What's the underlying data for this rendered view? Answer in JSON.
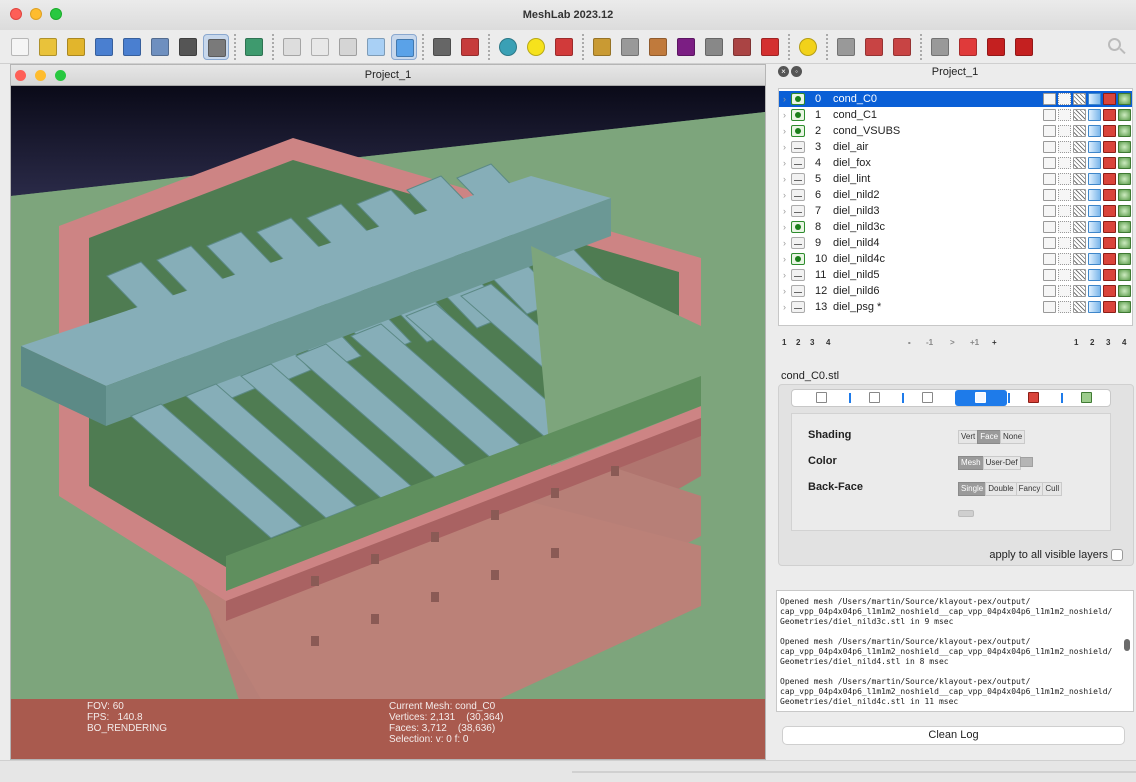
{
  "app": {
    "window_title": "MeshLab 2023.12"
  },
  "toolbar": {
    "icons": [
      {
        "name": "new-project-icon",
        "color": "#f5f5f5"
      },
      {
        "name": "open-project-icon",
        "color": "#e9c23a"
      },
      {
        "name": "import-mesh-icon",
        "color": "#e2b52c"
      },
      {
        "name": "reload-icon",
        "color": "#4a7fd0"
      },
      {
        "name": "reload-all-icon",
        "color": "#4a7fd0"
      },
      {
        "name": "export-mesh-icon",
        "color": "#6e8fbf"
      },
      {
        "name": "snapshot-icon",
        "color": "#555555"
      },
      {
        "name": "layers-icon",
        "color": "#7a7a7a",
        "active": true
      },
      {
        "name": "raster-icon",
        "color": "#3e9a6e"
      },
      {
        "name": "bbox-icon",
        "color": "#dddddd"
      },
      {
        "name": "points-icon",
        "color": "#e8e8e8"
      },
      {
        "name": "wireframe-icon",
        "color": "#d5d5d5"
      },
      {
        "name": "flat-shading-icon",
        "color": "#a9d0f5"
      },
      {
        "name": "smooth-shading-icon",
        "color": "#5aa2e8",
        "active": true
      },
      {
        "name": "grid-icon",
        "color": "#666666"
      },
      {
        "name": "axis-icon",
        "color": "#c63b3b"
      },
      {
        "name": "trackball-icon",
        "color": "#3aa0b5"
      },
      {
        "name": "info-a-icon",
        "color": "#f6e21c"
      },
      {
        "name": "axes-icon",
        "color": "#d13a3a"
      },
      {
        "name": "rough-pen-icon",
        "color": "#c99a33"
      },
      {
        "name": "raster-align-icon",
        "color": "#999999"
      },
      {
        "name": "paint-icon",
        "color": "#c07a3c"
      },
      {
        "name": "p-tool-icon",
        "color": "#7b1e83"
      },
      {
        "name": "select-vertices-icon",
        "color": "#888888"
      },
      {
        "name": "select-faces-icon",
        "color": "#aa4444"
      },
      {
        "name": "georef-icon",
        "color": "#d43030"
      },
      {
        "name": "info-i-icon",
        "color": "#f2d21a"
      },
      {
        "name": "select-conn-icon",
        "color": "#999999"
      },
      {
        "name": "select-faces-alt-icon",
        "color": "#c84444"
      },
      {
        "name": "select-more-icon",
        "color": "#c84444"
      },
      {
        "name": "select-clear-icon",
        "color": "#999999"
      },
      {
        "name": "delete-vertices-icon",
        "color": "#e03a3a"
      },
      {
        "name": "delete-faces-icon",
        "color": "#c42020"
      },
      {
        "name": "delete-all-icon",
        "color": "#c42020"
      }
    ]
  },
  "subwindow": {
    "title": "Project_1"
  },
  "info_left": [
    "FOV: 60",
    "FPS:   140.8",
    "BO_RENDERING"
  ],
  "info_right": [
    "Current Mesh: cond_C0",
    "Vertices: 2,131    (30,364)",
    "Faces: 3,712    (38,636)",
    "Selection: v: 0 f: 0"
  ],
  "panel": {
    "title": "Project_1",
    "layers": [
      {
        "id": "0",
        "name": "cond_C0",
        "visible": true,
        "selected": true
      },
      {
        "id": "1",
        "name": "cond_C1",
        "visible": true
      },
      {
        "id": "2",
        "name": "cond_VSUBS",
        "visible": true
      },
      {
        "id": "3",
        "name": "diel_air",
        "visible": false
      },
      {
        "id": "4",
        "name": "diel_fox",
        "visible": false
      },
      {
        "id": "5",
        "name": "diel_lint",
        "visible": false
      },
      {
        "id": "6",
        "name": "diel_nild2",
        "visible": false
      },
      {
        "id": "7",
        "name": "diel_nild3",
        "visible": false
      },
      {
        "id": "8",
        "name": "diel_nild3c",
        "visible": true
      },
      {
        "id": "9",
        "name": "diel_nild4",
        "visible": false
      },
      {
        "id": "10",
        "name": "diel_nild4c",
        "visible": true
      },
      {
        "id": "11",
        "name": "diel_nild5",
        "visible": false
      },
      {
        "id": "12",
        "name": "diel_nild6",
        "visible": false
      },
      {
        "id": "13",
        "name": "diel_psg *",
        "visible": false
      }
    ],
    "tags": [
      "1",
      "2",
      "3",
      "4",
      "-",
      "-1",
      ">",
      "+1",
      "+",
      "1",
      "2",
      "3",
      "4"
    ],
    "current_mesh_file": "cond_C0.stl",
    "render": {
      "shading_label": "Shading",
      "shading_options": [
        "Vert",
        "Face",
        "None"
      ],
      "shading_selected": "Face",
      "color_label": "Color",
      "color_options": [
        "Mesh",
        "User-Def"
      ],
      "color_selected": "Mesh",
      "backface_label": "Back-Face",
      "backface_options": [
        "Single",
        "Double",
        "Fancy",
        "Cull"
      ],
      "backface_selected": "Single",
      "apply_all": "apply to all visible layers"
    },
    "log": [
      "Opened mesh /Users/martin/Source/klayout-pex/output/\ncap_vpp_04p4x04p6_l1m1m2_noshield__cap_vpp_04p4x04p6_l1m1m2_noshield/\nGeometries/diel_nild3c.stl in 9 msec",
      "Opened mesh /Users/martin/Source/klayout-pex/output/\ncap_vpp_04p4x04p6_l1m1m2_noshield__cap_vpp_04p4x04p6_l1m1m2_noshield/\nGeometries/diel_nild4.stl in 8 msec",
      "Opened mesh /Users/martin/Source/klayout-pex/output/\ncap_vpp_04p4x04p6_l1m1m2_noshield__cap_vpp_04p4x04p6_l1m1m2_noshield/\nGeometries/diel_nild4c.stl in 11 msec"
    ],
    "clean_log": "Clean Log"
  },
  "colors": {
    "green_face": "#7da57c",
    "green_dark": "#4f7c52",
    "pink": "#cd8484",
    "pink_dark": "#a96262",
    "blue_top": "#86aeb8",
    "blue_side": "#5c8a86",
    "info_bg": "#a95a4e",
    "selected_row": "#0a5fd6"
  }
}
